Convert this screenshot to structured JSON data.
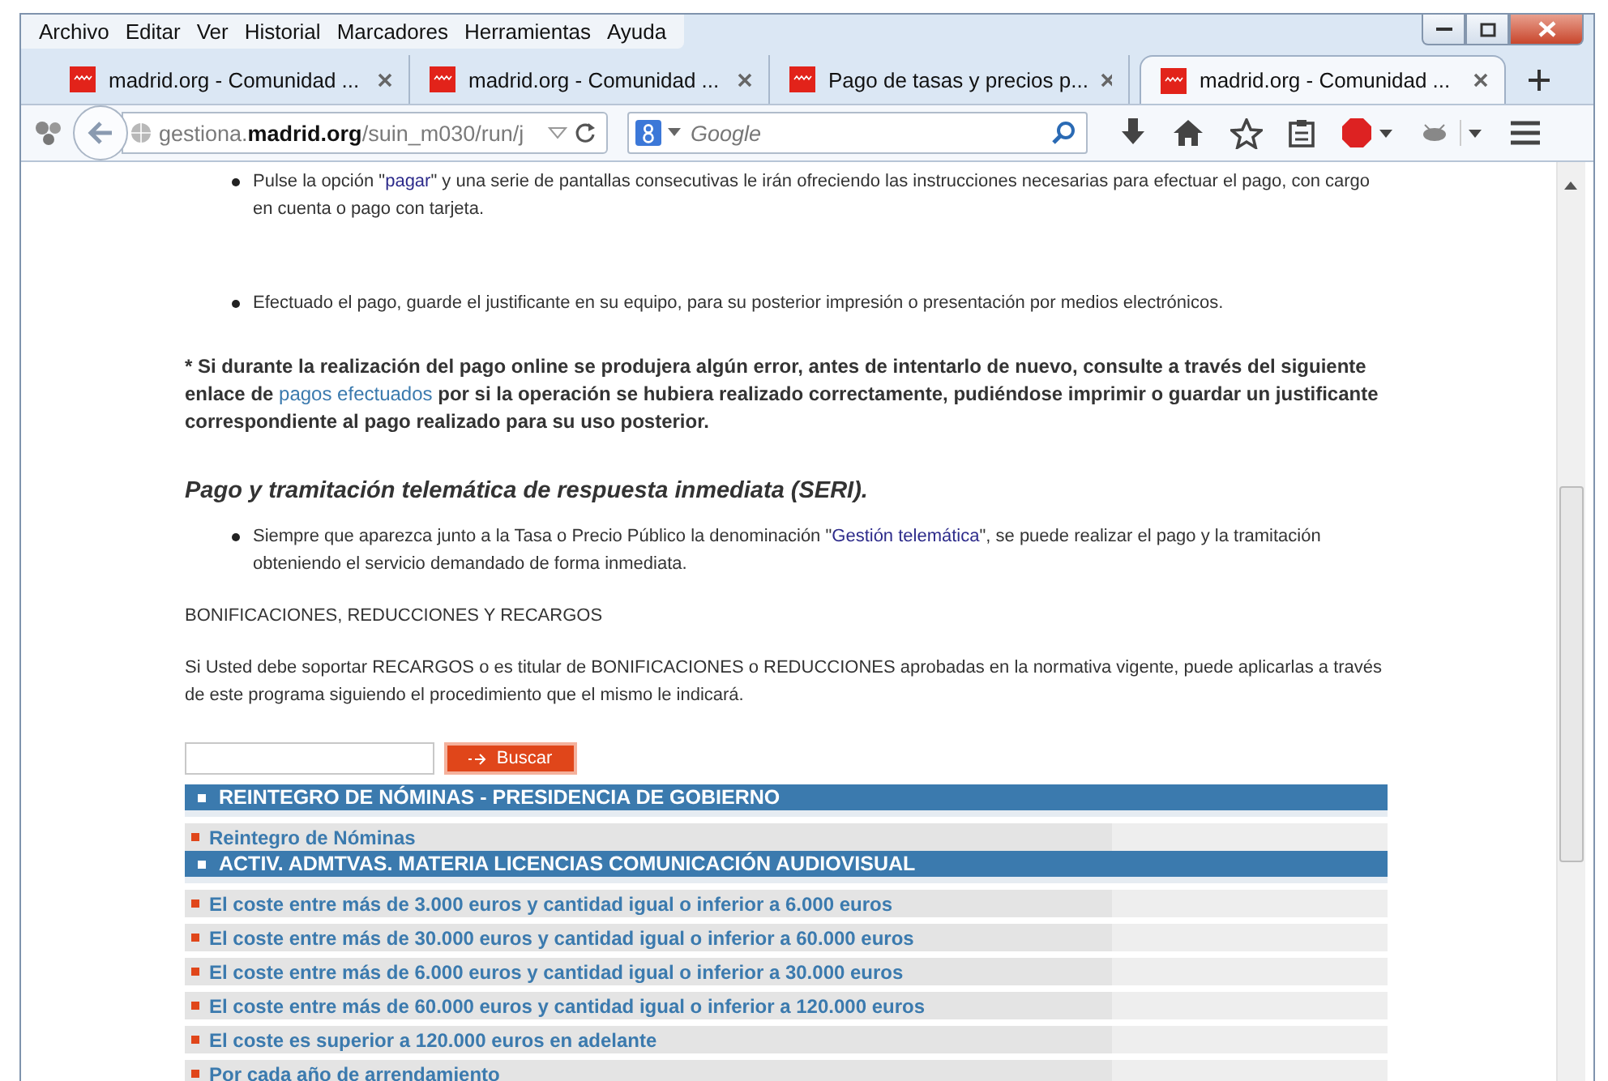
{
  "menu_bar": [
    "Archivo",
    "Editar",
    "Ver",
    "Historial",
    "Marcadores",
    "Herramientas",
    "Ayuda"
  ],
  "tabs": [
    {
      "title": "madrid.org - Comunidad ...",
      "selected": false
    },
    {
      "title": "madrid.org - Comunidad ...",
      "selected": false
    },
    {
      "title": "Pago de tasas y precios p...",
      "selected": false
    },
    {
      "title": "madrid.org - Comunidad ...",
      "selected": true
    }
  ],
  "address_bar": {
    "url": "gestiona.**madrid.org**/suin_m030/run/j"
  },
  "search_field": {
    "placeholder": "Google"
  },
  "bullets_top": [
    {
      "before": "Pulse la opción \"",
      "link": "pagar",
      "after": "\" y una serie de pantallas consecutivas le irán ofreciendo las instrucciones necesarias para efectuar el pago, con cargo en cuenta o pago con tarjeta."
    },
    {
      "before": "Efectuado el pago, guarde el justificante en su equipo, para su posterior impresión o presentación por medios electrónicos."
    }
  ],
  "note": {
    "before": "* Si durante la realización del pago online se produjera algún error, antes de intentarlo de nuevo, consulte a través del siguiente enlace de ",
    "link": "pagos efectuados",
    "after": " por si la operación se hubiera realizado correctamente, pudiéndose imprimir o guardar un justificante correspondiente al pago realizado para su uso posterior."
  },
  "section_title": "Pago y tramitación telemática de respuesta inmediata (SERI).",
  "bullets_seri": [
    {
      "before": "Siempre que aparezca junto a la Tasa o Precio Público la denominación \"",
      "link": "Gestión telemática",
      "after": "\", se puede realizar el pago y la tramitación obteniendo el servicio demandado de forma inmediata."
    }
  ],
  "plain_heading": "BONIFICACIONES, REDUCCIONES Y RECARGOS",
  "paragraph": "Si Usted debe soportar RECARGOS o es titular de BONIFICACIONES o REDUCCIONES aprobadas en la normativa vigente, puede aplicarlas a través de este programa siguiendo el procedimiento que el mismo le indicará.",
  "search_button": "Buscar",
  "groups": [
    {
      "title": "REINTEGRO DE NÓMINAS - PRESIDENCIA DE GOBIERNO",
      "items": [
        "Reintegro de Nóminas"
      ]
    },
    {
      "title": "ACTIV. ADMTVAS. MATERIA LICENCIAS COMUNICACIÓN AUDIOVISUAL",
      "items": [
        "El coste entre más de 3.000 euros y cantidad igual o inferior a 6.000 euros",
        "El coste entre más de 30.000 euros y cantidad igual o inferior a 60.000 euros",
        "El coste entre más de 6.000 euros y cantidad igual o inferior a 30.000 euros",
        "El coste entre más de 60.000 euros y cantidad igual o inferior a 120.000 euros",
        "El coste es superior a 120.000 euros en adelante",
        "Por cada año de arrendamiento"
      ]
    }
  ]
}
